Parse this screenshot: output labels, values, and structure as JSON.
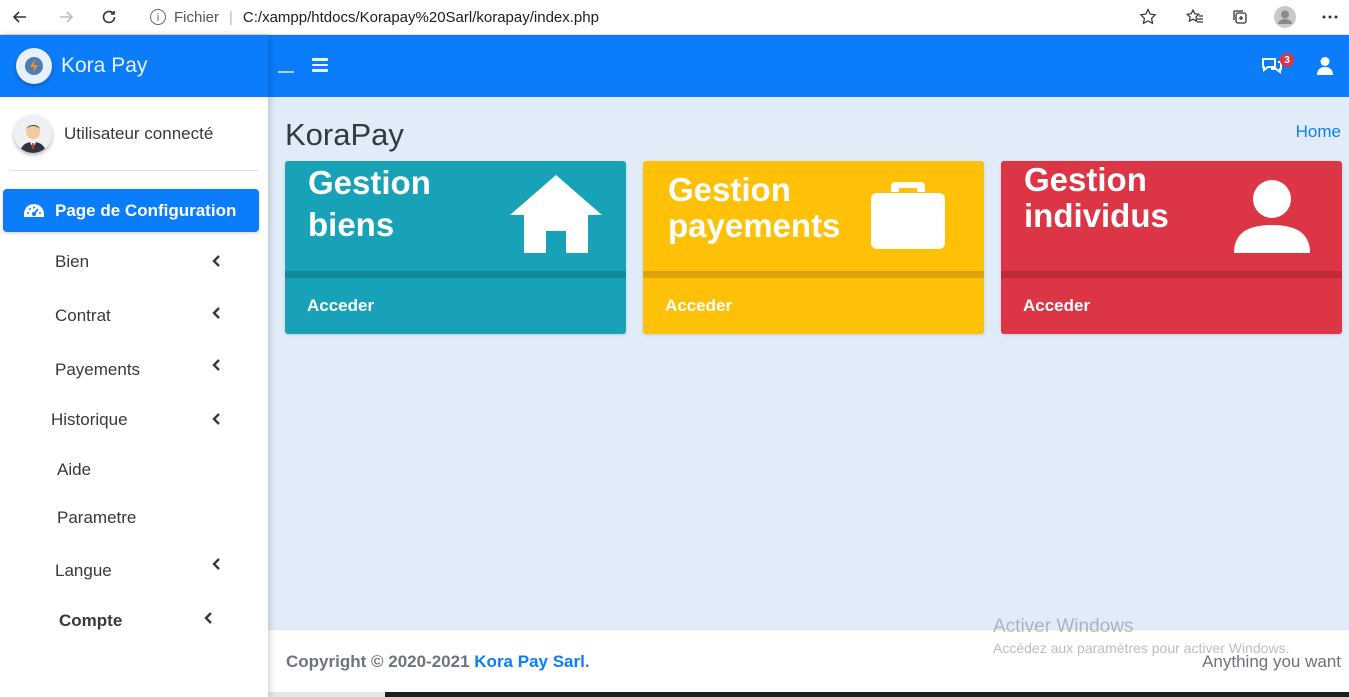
{
  "browser": {
    "scheme_label": "Fichier",
    "url": "C:/xampp/htdocs/Korapay%20Sarl/korapay/index.php",
    "info_glyph": "i"
  },
  "sidebar": {
    "brand": "Kora Pay",
    "user_name": "Utilisateur connecté",
    "active_item": "Page de Configuration",
    "items": [
      {
        "label": "Bien",
        "has_submenu": true
      },
      {
        "label": "Contrat",
        "has_submenu": true
      },
      {
        "label": "Payements",
        "has_submenu": true
      },
      {
        "label": "Historique",
        "has_submenu": true
      },
      {
        "label": "Aide",
        "has_submenu": false
      },
      {
        "label": "Parametre",
        "has_submenu": false
      },
      {
        "label": "Langue",
        "has_submenu": true
      },
      {
        "label": "Compte",
        "has_submenu": true
      }
    ]
  },
  "navbar": {
    "messages_count": "3"
  },
  "main": {
    "title": "KoraPay",
    "breadcrumb": "Home",
    "cards": [
      {
        "title_line1": "Gestion",
        "title_line2": "biens",
        "action": "Acceder",
        "color": "#17a2b8",
        "icon": "home-icon"
      },
      {
        "title_line1": "Gestion",
        "title_line2": "payements",
        "action": "Acceder",
        "color": "#ffc107",
        "icon": "briefcase-icon"
      },
      {
        "title_line1": "Gestion",
        "title_line2": "individus",
        "action": "Acceder",
        "color": "#dc3545",
        "icon": "user-icon"
      }
    ]
  },
  "footer": {
    "copyright_prefix": "Copyright © 2020-2021",
    "company": "Kora Pay Sarl",
    "suffix": ".",
    "tagline": "Anything you want"
  },
  "watermark": {
    "line1": "Activer Windows",
    "line2": "Accédez aux paramètres pour activer Windows."
  },
  "colors": {
    "primary": "#0b7dfb",
    "content_bg": "#e0edf9"
  }
}
